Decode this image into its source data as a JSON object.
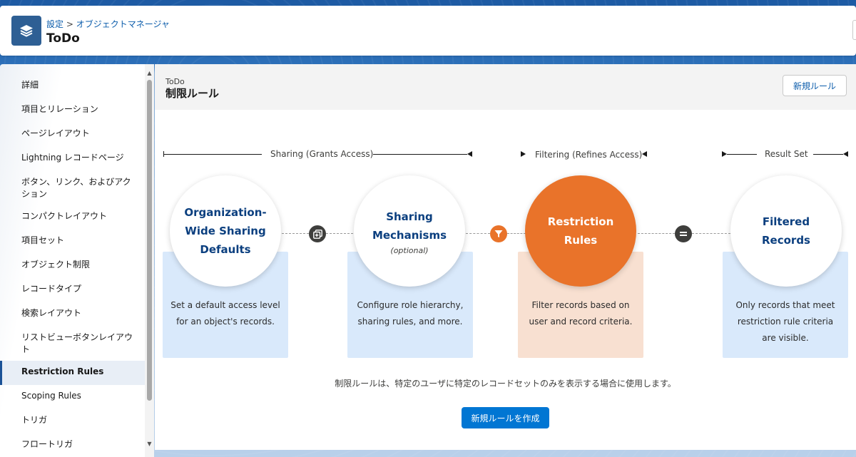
{
  "header": {
    "breadcrumb_root": "設定",
    "breadcrumb_sep": " > ",
    "breadcrumb_current": "オブジェクトマネージャ",
    "title": "ToDo"
  },
  "sidebar": {
    "items": [
      {
        "label": "詳細"
      },
      {
        "label": "項目とリレーション"
      },
      {
        "label": "ページレイアウト"
      },
      {
        "label": "Lightning レコードページ"
      },
      {
        "label": "ボタン、リンク、およびアクション"
      },
      {
        "label": "コンパクトレイアウト"
      },
      {
        "label": "項目セット"
      },
      {
        "label": "オブジェクト制限"
      },
      {
        "label": "レコードタイプ"
      },
      {
        "label": "検索レイアウト"
      },
      {
        "label": "リストビューボタンレイアウト"
      },
      {
        "label": "Restriction Rules",
        "active": true
      },
      {
        "label": "Scoping Rules"
      },
      {
        "label": "トリガ"
      },
      {
        "label": "フロートリガ"
      }
    ]
  },
  "main": {
    "object_name": "ToDo",
    "section_title": "制限ルール",
    "new_rule_button": "新規ルール",
    "usage_text": "制限ルールは、特定のユーザに特定のレコードセットのみを表示する場合に使用します。",
    "create_button": "新規ルールを作成"
  },
  "diagram": {
    "ranges": {
      "sharing": "Sharing (Grants Access)",
      "filtering": "Filtering (Refines Access)",
      "result": "Result Set"
    },
    "steps": [
      {
        "title_line1": "Organization-",
        "title_line2": "Wide Sharing",
        "title_line3": "Defaults",
        "description_line1": "Set a default access level",
        "description_line2": "for an object's records."
      },
      {
        "title_line1": "Sharing",
        "title_line2": "Mechanisms",
        "subtitle": "(optional)",
        "description_line1": "Configure role hierarchy,",
        "description_line2": "sharing rules, and more."
      },
      {
        "title_line1": "Restriction",
        "title_line2": "Rules",
        "description_line1": "Filter records based on",
        "description_line2": "user and record criteria."
      },
      {
        "title_line1": "Filtered",
        "title_line2": "Records",
        "description_line1": "Only records that meet",
        "description_line2": "restriction rule criteria",
        "description_line3": "are visible."
      }
    ],
    "operators": [
      "plus-copy-icon",
      "filter-icon",
      "equals-icon"
    ],
    "colors": {
      "accent_orange": "#e9732a",
      "card_blue": "#d9e9fb",
      "card_peach": "#f8e0d1",
      "title_blue": "#0b3f7f",
      "button_blue": "#0176d3"
    }
  }
}
